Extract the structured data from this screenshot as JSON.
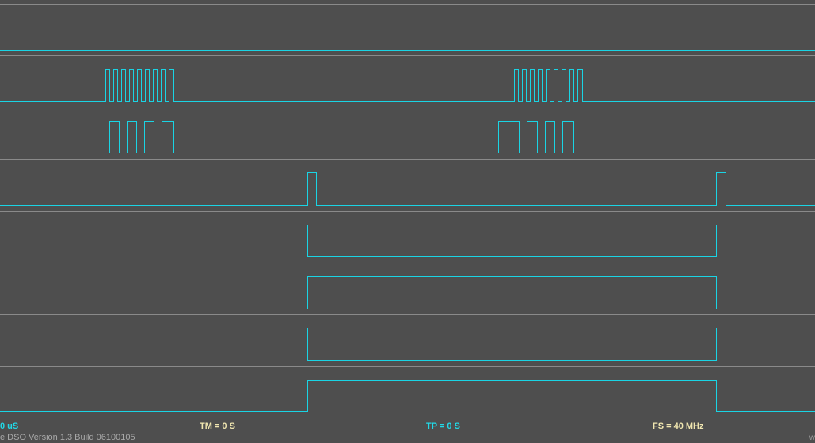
{
  "status_bar": {
    "left_readout": "0 uS",
    "tm_readout": "TM = 0 S",
    "tp_readout": "TP = 0 S",
    "fs_readout": "FS = 40 MHz"
  },
  "footer": {
    "version_text": "e DSO Version 1.3 Build 06100105",
    "corner_text": "w"
  },
  "colors": {
    "background": "#4e4e4e",
    "grid": "#8a8a8a",
    "trace": "#1ad4e4",
    "readout_cyan": "#22d8e6",
    "readout_cream": "#f0e6b0",
    "version_text": "#a9a9a9"
  },
  "channels": [
    {
      "name": "",
      "initial_level": "low",
      "transitions": []
    },
    {
      "name": "",
      "initial_level": "low",
      "transitions": [
        133,
        138,
        143,
        148,
        153,
        158,
        163,
        168,
        173,
        178,
        183,
        188,
        193,
        198,
        203,
        208,
        213,
        219,
        649,
        654,
        659,
        664,
        669,
        674,
        679,
        684,
        689,
        694,
        699,
        704,
        709,
        714,
        719,
        724,
        729,
        735
      ]
    },
    {
      "name": "",
      "initial_level": "low",
      "transitions": [
        138,
        150,
        160,
        172,
        182,
        194,
        204,
        219,
        629,
        655,
        665,
        678,
        688,
        700,
        710,
        724
      ]
    },
    {
      "name": "",
      "initial_level": "low",
      "transitions": [
        388,
        399,
        904,
        916
      ]
    },
    {
      "name": "",
      "initial_level": "high",
      "transitions": [
        388,
        904
      ]
    },
    {
      "name": "",
      "initial_level": "low",
      "transitions": [
        388,
        904
      ]
    },
    {
      "name": "",
      "initial_level": "high",
      "transitions": [
        388,
        904
      ]
    },
    {
      "name": "",
      "initial_level": "low",
      "transitions": [
        388,
        904
      ]
    }
  ]
}
